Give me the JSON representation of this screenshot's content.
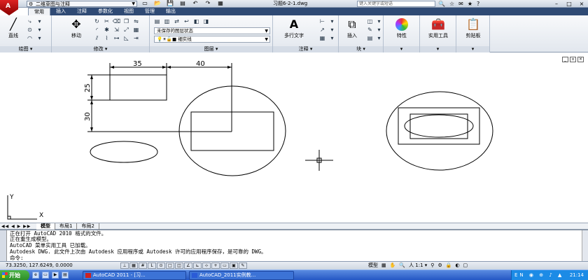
{
  "titlebar": {
    "logo": "A",
    "workspace": "二维草图与注释",
    "document_title": "习题6-2-1.dwg",
    "search_placeholder": "键入关键字或短语",
    "qat_icons": [
      "new-icon",
      "open-icon",
      "save-icon",
      "print-icon",
      "undo-icon",
      "redo-icon",
      "plot-icon"
    ],
    "window_controls": [
      "–",
      "□",
      "×"
    ]
  },
  "ribbon_tabs": [
    "常用",
    "插入",
    "注释",
    "参数化",
    "视图",
    "管理",
    "输出"
  ],
  "ribbon": {
    "draw_panel": {
      "title": "绘图",
      "line_label": "直线"
    },
    "modify_panel": {
      "title": "修改",
      "move_label": "移动"
    },
    "layers_panel": {
      "title": "图层",
      "state_combo": "未保存的图层状态",
      "layer_combo": "细实线",
      "layer_prefix": "0"
    },
    "annotation_panel": {
      "title": "注释",
      "mtext_label": "多行文字"
    },
    "block_panel": {
      "title": "块",
      "insert_label": "插入"
    },
    "properties_label": "特性",
    "utilities_label": "实用工具",
    "clipboard_label": "剪贴板"
  },
  "drawing": {
    "dims": {
      "d35": "35",
      "d40": "40",
      "d25": "25",
      "d30": "30"
    },
    "ucs": {
      "x": "X",
      "y": "Y"
    }
  },
  "layout_tabs": {
    "nav": "◀◀ ◀ ▶ ▶▶",
    "tabs": [
      "模型",
      "布局1",
      "布局2"
    ]
  },
  "command_lines": [
    "正在打开 AutoCAD 2010 格式的文件。",
    "正在重生成模型。",
    "AutoCAD 菜单实用工具 已加载。",
    "Autodesk DWG.  此文件上次由 Autodesk 应用程序或 Autodesk 许可的应用程序保存，是可靠的 DWG。",
    "命令:"
  ],
  "statusbar": {
    "coordinates": "73.3250, 127.6249, 0.0000",
    "model_label": "模型",
    "annotation_scale": "人 1:1 ▾"
  },
  "taskbar": {
    "start_label": "开始",
    "tasks": [
      "AutoCAD 2011 - [习...",
      "AutoCAD_2011实例教..."
    ],
    "clock": "21:14",
    "tray_lang": "EN"
  }
}
